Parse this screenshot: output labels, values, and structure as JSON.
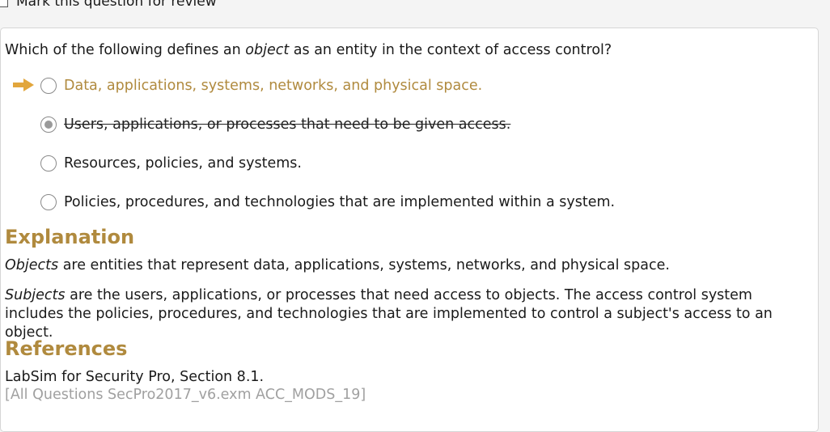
{
  "review": {
    "label": "Mark this question for review"
  },
  "question": {
    "prefix": "Which of the following defines an ",
    "object_word": "object",
    "suffix": " as an entity in the context of access control?"
  },
  "options": [
    {
      "label": "Data, applications, systems, networks, and physical space.",
      "state": "correct"
    },
    {
      "label": "Users, applications, or processes that need to be given access.",
      "state": "selected-wrong"
    },
    {
      "label": "Resources, policies, and systems.",
      "state": "unselected"
    },
    {
      "label": "Policies, procedures, and technologies that are implemented within a system.",
      "state": "unselected"
    }
  ],
  "explanation": {
    "heading": "Explanation",
    "p1_term": "Objects",
    "p1_rest": " are entities that represent data, applications, systems, networks, and physical space.",
    "p2_term": "Subjects",
    "p2_rest": " are the users, applications, or processes that need access to objects. The access control system includes the policies, procedures, and technologies that are implemented to control a subject's access to an object."
  },
  "references": {
    "heading": "References",
    "source": "LabSim for Security Pro, Section 8.1.",
    "id": "[All Questions SecPro2017_v6.exm ACC_MODS_19]"
  },
  "colors": {
    "accent": "#b08a3e",
    "arrow": "#e2a63c"
  }
}
